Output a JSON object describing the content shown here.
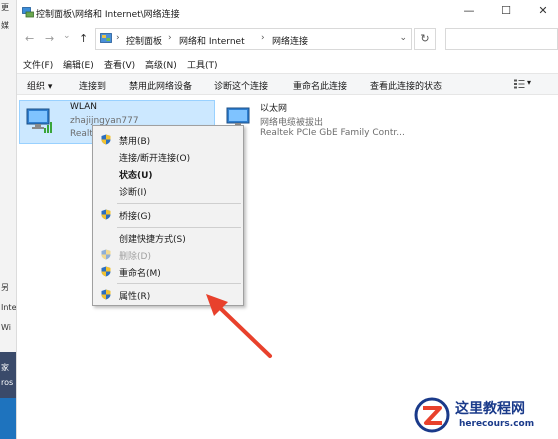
{
  "left_strip": {
    "labels": [
      "更",
      "媒",
      "另",
      "Inte",
      "Wi"
    ],
    "bottom_labels": [
      "家",
      "ros"
    ]
  },
  "window": {
    "title": "控制面板\\网络和 Internet\\网络连接",
    "minimize": "—",
    "maximize": "☐",
    "close": "✕"
  },
  "nav": {
    "back": "←",
    "forward": "→",
    "history": "⌄",
    "up": "↑",
    "refresh": "↻"
  },
  "address": {
    "crumbs": [
      "控制面板",
      "网络和 Internet",
      "网络连接"
    ],
    "separator": "›",
    "dropdown": "⌄"
  },
  "menu": [
    "文件(F)",
    "编辑(E)",
    "查看(V)",
    "高级(N)",
    "工具(T)"
  ],
  "toolbar": {
    "organize": "组织 ▾",
    "items": [
      "连接到",
      "禁用此网络设备",
      "诊断这个连接",
      "重命名此连接",
      "查看此连接的状态"
    ],
    "view_dd": "▾"
  },
  "connections": [
    {
      "name": "WLAN",
      "sub": "zhajijngyan777",
      "sub2": "Realtek"
    },
    {
      "name": "以太网",
      "sub": "网络电缆被拔出",
      "sub2": "Realtek PCIe GbE Family Contr..."
    }
  ],
  "context_menu": {
    "items": [
      {
        "label": "禁用(B)",
        "shield": true,
        "bold": false,
        "disabled": false
      },
      {
        "label": "连接/断开连接(O)",
        "shield": false,
        "bold": false,
        "disabled": false
      },
      {
        "label": "状态(U)",
        "shield": false,
        "bold": true,
        "disabled": false
      },
      {
        "label": "诊断(I)",
        "shield": false,
        "bold": false,
        "disabled": false
      },
      {
        "label": "桥接(G)",
        "shield": true,
        "bold": false,
        "disabled": false
      },
      {
        "label": "创建快捷方式(S)",
        "shield": false,
        "bold": false,
        "disabled": false
      },
      {
        "label": "删除(D)",
        "shield": true,
        "bold": false,
        "disabled": true
      },
      {
        "label": "重命名(M)",
        "shield": true,
        "bold": false,
        "disabled": false
      },
      {
        "label": "属性(R)",
        "shield": true,
        "bold": false,
        "disabled": false
      }
    ]
  },
  "watermark": {
    "title": "这里教程网",
    "url": "herecours.com"
  },
  "colors": {
    "selection": "#cce8ff",
    "arrow": "#e8412c",
    "watermark": "#1a3a8a"
  }
}
